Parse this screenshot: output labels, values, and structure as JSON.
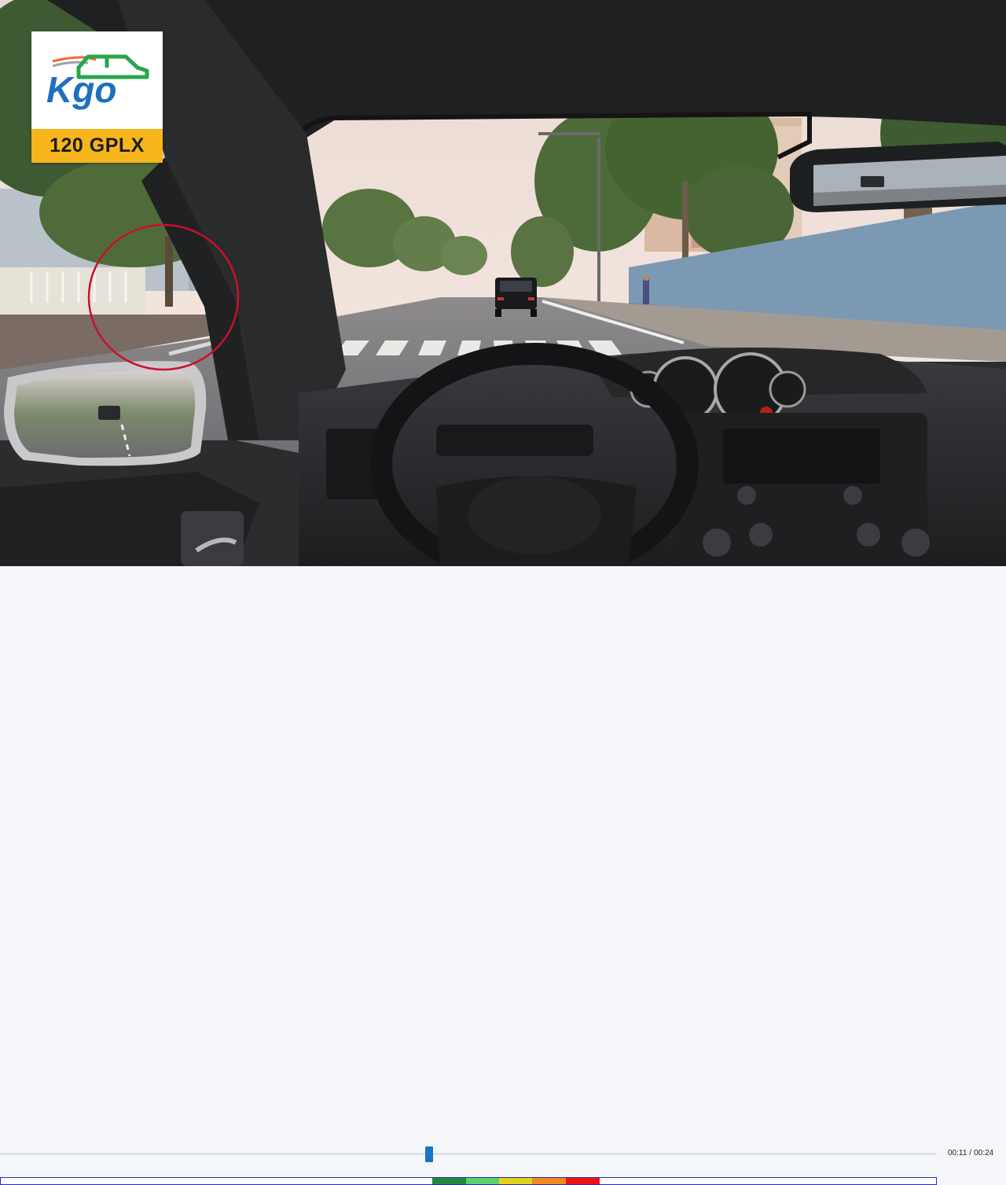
{
  "logo": {
    "brand": "Kgo",
    "caption": "120 GPLX"
  },
  "player": {
    "current_time": "00:11",
    "duration": "00:24",
    "progress": 0.4583,
    "score_segments": [
      {
        "level": 1,
        "color": "#1e8a3a"
      },
      {
        "level": 2,
        "color": "#5ad06a"
      },
      {
        "level": 3,
        "color": "#e3d21a"
      },
      {
        "level": 4,
        "color": "#f08a1e"
      },
      {
        "level": 5,
        "color": "#ee1111"
      }
    ],
    "score_window": {
      "start": 0.4615,
      "end": 0.6395
    }
  },
  "colors": {
    "accent": "#1b73c7",
    "highlight_circle": "#c8102e",
    "logo_blue": "#1f6fc0",
    "logo_green": "#27a64a",
    "logo_orange": "#f7b51c"
  },
  "icons": {
    "logo_car": "car-outline-icon"
  }
}
